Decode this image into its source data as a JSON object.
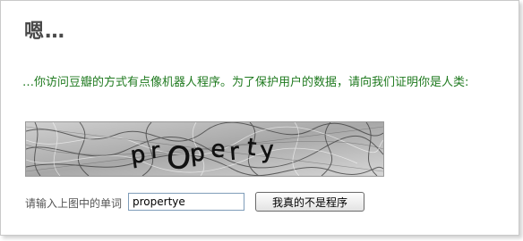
{
  "page": {
    "title": "嗯…",
    "message": "…你访问豆瓣的方式有点像机器人程序。为了保护用户的数据，请向我们证明你是人类:"
  },
  "captcha": {
    "image_text": "property"
  },
  "form": {
    "input_label": "请输入上图中的单词",
    "input_value": "propertye",
    "submit_label": "我真的不是程序"
  },
  "colors": {
    "message": "#1f7a1f",
    "title": "#494949"
  }
}
